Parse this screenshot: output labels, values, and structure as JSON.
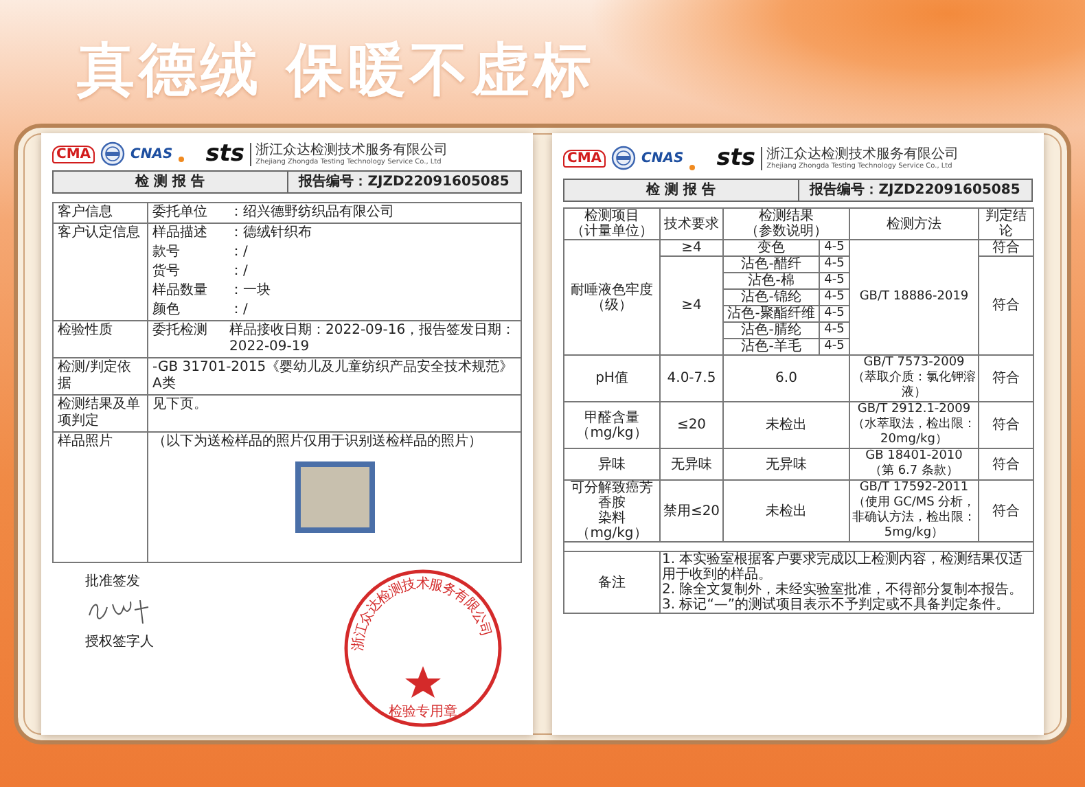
{
  "title": "真德绒 保暖不虚标",
  "reports": [
    {
      "kind": "summary",
      "header": {
        "cma": "CMA",
        "cnas": "CNAS",
        "brand": "sts",
        "company": "浙江众达检测技术服务有限公司",
        "company_en": "Zhejiang Zhongda Testing Technology Service Co., Ltd",
        "report_title": "检 测 报 告",
        "report_number": "报告编号：ZJZD22091605085"
      },
      "info_rows": [
        {
          "label": "客户信息",
          "lines": [
            {
              "name": "委托单位",
              "value": "：绍兴德野纺织品有限公司"
            }
          ]
        },
        {
          "label": "客户认定信息",
          "lines": [
            {
              "name": "样品描述",
              "value": "：德绒针织布"
            },
            {
              "name": "款号",
              "value": "：/"
            },
            {
              "name": "货号",
              "value": "：/"
            },
            {
              "name": "样品数量",
              "value": "：一块"
            },
            {
              "name": "颜色",
              "value": "：/"
            }
          ]
        },
        {
          "label": "检验性质",
          "lines": [
            {
              "name": "委托检测",
              "value": "样品接收日期：2022-09-16，报告签发日期：2022-09-19"
            }
          ]
        },
        {
          "label": "检测/判定依据",
          "lines": [
            {
              "value": "-GB 31701-2015《婴幼儿及儿童纺织产品安全技术规范》 A类"
            }
          ]
        },
        {
          "label": "检测结果及单项判定",
          "lines": [
            {
              "value": "见下页。"
            }
          ]
        }
      ],
      "photo_row": {
        "label": "样品照片",
        "note": "（以下为送检样品的照片仅用于识别送检样品的照片）"
      },
      "approver_label": "批准签发",
      "signer_label": "授权签字人",
      "stamp_ring": "浙江众达检测技术服务有限公司",
      "stamp_text": "检验专用章"
    },
    {
      "kind": "results",
      "header": {
        "cma": "CMA",
        "cnas": "CNAS",
        "brand": "sts",
        "company": "浙江众达检测技术服务有限公司",
        "company_en": "Zhejiang Zhongda Testing Technology Service Co., Ltd",
        "report_title": "检 测 报 告",
        "report_number": "报告编号：ZJZD22091605085"
      },
      "columns": [
        {
          "lines": [
            "检测项目",
            "（计量单位）"
          ]
        },
        {
          "lines": [
            "技术要求"
          ]
        },
        {
          "lines": [
            "检测结果",
            "（参数说明）"
          ]
        },
        {
          "lines": [
            "检测方法"
          ]
        },
        {
          "lines": [
            "判定结论"
          ]
        }
      ],
      "rows": [
        {
          "kind": "graded",
          "item": [
            "耐唾液色牢度",
            "（级）"
          ],
          "method": [
            "GB/T 18886-2019"
          ],
          "bands": [
            {
              "requirement": "≥4",
              "verdict": "符合",
              "results": [
                {
                  "name": "变色",
                  "grade": "4-5"
                }
              ]
            },
            {
              "requirement": "≥4",
              "verdict": "符合",
              "results": [
                {
                  "name": "沾色-醋纤",
                  "grade": "4-5"
                },
                {
                  "name": "沾色-棉",
                  "grade": "4-5"
                },
                {
                  "name": "沾色-锦纶",
                  "grade": "4-5"
                },
                {
                  "name": "沾色-聚酯纤维",
                  "grade": "4-5"
                },
                {
                  "name": "沾色-腈纶",
                  "grade": "4-5"
                },
                {
                  "name": "沾色-羊毛",
                  "grade": "4-5"
                }
              ]
            }
          ]
        },
        {
          "kind": "simple",
          "item": [
            "pH值"
          ],
          "requirement": "4.0-7.5",
          "result": "6.0",
          "method": [
            "GB/T 7573-2009",
            "（萃取介质：氯化钾溶液）"
          ],
          "verdict": "符合"
        },
        {
          "kind": "simple",
          "item": [
            "甲醛含量",
            "（mg/kg）"
          ],
          "requirement": "≤20",
          "result": "未检出",
          "method": [
            "GB/T 2912.1-2009",
            "（水萃取法，检出限：",
            "20mg/kg）"
          ],
          "verdict": "符合"
        },
        {
          "kind": "simple",
          "item": [
            "异味"
          ],
          "requirement": "无异味",
          "result": "无异味",
          "method": [
            "GB 18401-2010",
            "（第 6.7 条款）"
          ],
          "verdict": "符合"
        },
        {
          "kind": "simple",
          "item": [
            "可分解致癌芳香胺",
            "染料",
            "（mg/kg）"
          ],
          "requirement": "禁用≤20",
          "result": "未检出",
          "method": [
            "GB/T 17592-2011",
            "（使用 GC/MS 分析，",
            "非确认方法，检出限：",
            "5mg/kg）"
          ],
          "verdict": "符合"
        },
        {
          "kind": "blank"
        }
      ],
      "remarks_label": "备注",
      "remarks": [
        "1. 本实验室根据客户要求完成以上检测内容，检测结果仅适用于收到的样品。",
        "2. 除全文复制外，未经实验室批准，不得部分复制本报告。",
        "3. 标记“—”的测试项目表示不予判定或不具备判定条件。"
      ]
    }
  ]
}
